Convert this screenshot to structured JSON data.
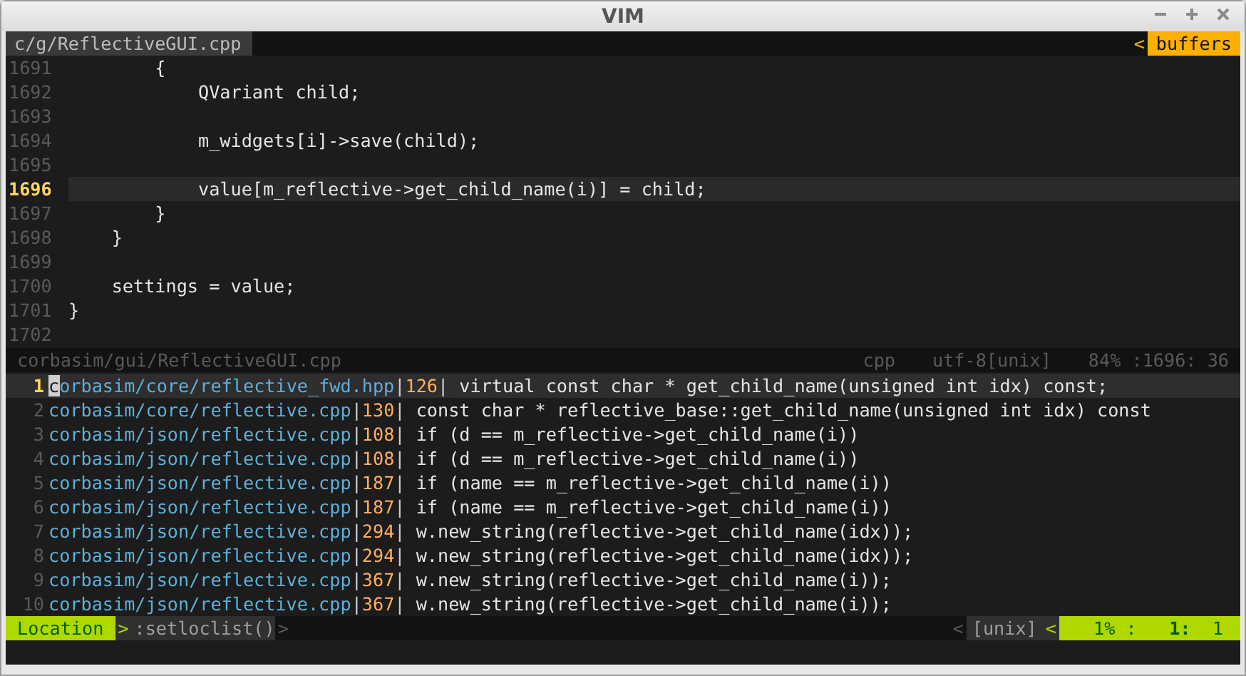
{
  "window": {
    "title": "VIM"
  },
  "tabline": {
    "tab": "c/g/ReflectiveGUI.cpp",
    "arrow": "<",
    "buffers": "buffers"
  },
  "code_lines": [
    {
      "number": "1691",
      "text": "        {",
      "current": false
    },
    {
      "number": "1692",
      "text": "            QVariant child;",
      "current": false
    },
    {
      "number": "1693",
      "current": false
    },
    {
      "number": "1694",
      "text": "            m_widgets[i]->save(child);",
      "current": false
    },
    {
      "number": "1695",
      "current": false
    },
    {
      "number": "1696",
      "text": "            value[m_reflective->get_child_name(i)] = child;",
      "current": true
    },
    {
      "number": "1697",
      "text": "        }",
      "current": false
    },
    {
      "number": "1698",
      "text": "    }",
      "current": false
    },
    {
      "number": "1699",
      "current": false
    },
    {
      "number": "1700",
      "text": "    settings = value;",
      "current": false
    },
    {
      "number": "1701",
      "text": "}",
      "current": false
    },
    {
      "number": "1702",
      "current": false
    }
  ],
  "upper_status": {
    "file": "corbasim/gui/ReflectiveGUI.cpp",
    "filetype": "cpp",
    "encoding": "utf-8[unix]",
    "position": "84% :1696: 36"
  },
  "location_separator": "|",
  "location_list": [
    {
      "number": "1",
      "file": "corbasim/core/reflective_fwd.hpp",
      "line": "126",
      "text": "virtual const char * get_child_name(unsigned int idx) const;",
      "selected": true
    },
    {
      "number": "2",
      "file": "corbasim/core/reflective.cpp",
      "line": "130",
      "text": "const char * reflective_base::get_child_name(unsigned int idx) const",
      "selected": false
    },
    {
      "number": "3",
      "file": "corbasim/json/reflective.cpp",
      "line": "108",
      "text": "if (d == m_reflective->get_child_name(i))",
      "selected": false
    },
    {
      "number": "4",
      "file": "corbasim/json/reflective.cpp",
      "line": "108",
      "text": "if (d == m_reflective->get_child_name(i))",
      "selected": false
    },
    {
      "number": "5",
      "file": "corbasim/json/reflective.cpp",
      "line": "187",
      "text": "if (name == m_reflective->get_child_name(i))",
      "selected": false
    },
    {
      "number": "6",
      "file": "corbasim/json/reflective.cpp",
      "line": "187",
      "text": "if (name == m_reflective->get_child_name(i))",
      "selected": false
    },
    {
      "number": "7",
      "file": "corbasim/json/reflective.cpp",
      "line": "294",
      "text": "w.new_string(reflective->get_child_name(idx));",
      "selected": false
    },
    {
      "number": "8",
      "file": "corbasim/json/reflective.cpp",
      "line": "294",
      "text": "w.new_string(reflective->get_child_name(idx));",
      "selected": false
    },
    {
      "number": "9",
      "file": "corbasim/json/reflective.cpp",
      "line": "367",
      "text": "w.new_string(reflective->get_child_name(i));",
      "selected": false
    },
    {
      "number": "10",
      "file": "corbasim/json/reflective.cpp",
      "line": "367",
      "text": "w.new_string(reflective->get_child_name(i));",
      "selected": false
    }
  ],
  "status_line": {
    "mode": "Location",
    "mode_arrow": ">",
    "command": ":setloclist()",
    "command_arrow": ">",
    "format_arrow": "<",
    "format": "[unix]",
    "position_arrow": "<",
    "percent": "1% :",
    "line": "1:",
    "column": "1"
  }
}
